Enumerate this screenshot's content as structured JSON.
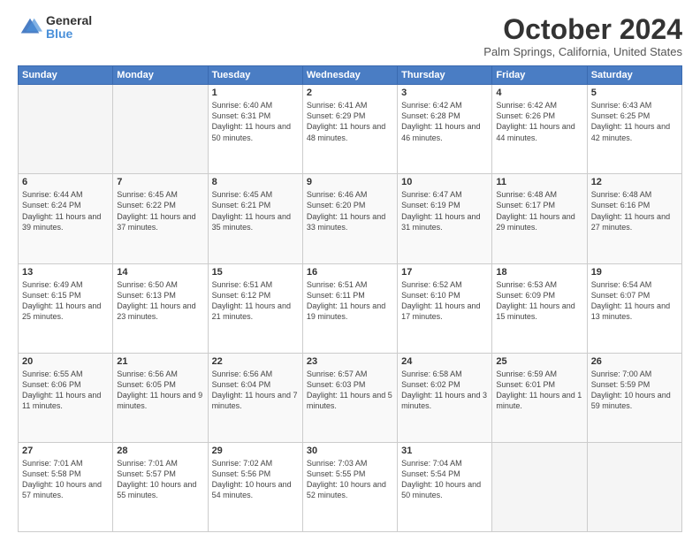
{
  "logo": {
    "general": "General",
    "blue": "Blue"
  },
  "header": {
    "month": "October 2024",
    "location": "Palm Springs, California, United States"
  },
  "weekdays": [
    "Sunday",
    "Monday",
    "Tuesday",
    "Wednesday",
    "Thursday",
    "Friday",
    "Saturday"
  ],
  "weeks": [
    [
      {
        "day": "",
        "info": ""
      },
      {
        "day": "",
        "info": ""
      },
      {
        "day": "1",
        "info": "Sunrise: 6:40 AM\nSunset: 6:31 PM\nDaylight: 11 hours and 50 minutes."
      },
      {
        "day": "2",
        "info": "Sunrise: 6:41 AM\nSunset: 6:29 PM\nDaylight: 11 hours and 48 minutes."
      },
      {
        "day": "3",
        "info": "Sunrise: 6:42 AM\nSunset: 6:28 PM\nDaylight: 11 hours and 46 minutes."
      },
      {
        "day": "4",
        "info": "Sunrise: 6:42 AM\nSunset: 6:26 PM\nDaylight: 11 hours and 44 minutes."
      },
      {
        "day": "5",
        "info": "Sunrise: 6:43 AM\nSunset: 6:25 PM\nDaylight: 11 hours and 42 minutes."
      }
    ],
    [
      {
        "day": "6",
        "info": "Sunrise: 6:44 AM\nSunset: 6:24 PM\nDaylight: 11 hours and 39 minutes."
      },
      {
        "day": "7",
        "info": "Sunrise: 6:45 AM\nSunset: 6:22 PM\nDaylight: 11 hours and 37 minutes."
      },
      {
        "day": "8",
        "info": "Sunrise: 6:45 AM\nSunset: 6:21 PM\nDaylight: 11 hours and 35 minutes."
      },
      {
        "day": "9",
        "info": "Sunrise: 6:46 AM\nSunset: 6:20 PM\nDaylight: 11 hours and 33 minutes."
      },
      {
        "day": "10",
        "info": "Sunrise: 6:47 AM\nSunset: 6:19 PM\nDaylight: 11 hours and 31 minutes."
      },
      {
        "day": "11",
        "info": "Sunrise: 6:48 AM\nSunset: 6:17 PM\nDaylight: 11 hours and 29 minutes."
      },
      {
        "day": "12",
        "info": "Sunrise: 6:48 AM\nSunset: 6:16 PM\nDaylight: 11 hours and 27 minutes."
      }
    ],
    [
      {
        "day": "13",
        "info": "Sunrise: 6:49 AM\nSunset: 6:15 PM\nDaylight: 11 hours and 25 minutes."
      },
      {
        "day": "14",
        "info": "Sunrise: 6:50 AM\nSunset: 6:13 PM\nDaylight: 11 hours and 23 minutes."
      },
      {
        "day": "15",
        "info": "Sunrise: 6:51 AM\nSunset: 6:12 PM\nDaylight: 11 hours and 21 minutes."
      },
      {
        "day": "16",
        "info": "Sunrise: 6:51 AM\nSunset: 6:11 PM\nDaylight: 11 hours and 19 minutes."
      },
      {
        "day": "17",
        "info": "Sunrise: 6:52 AM\nSunset: 6:10 PM\nDaylight: 11 hours and 17 minutes."
      },
      {
        "day": "18",
        "info": "Sunrise: 6:53 AM\nSunset: 6:09 PM\nDaylight: 11 hours and 15 minutes."
      },
      {
        "day": "19",
        "info": "Sunrise: 6:54 AM\nSunset: 6:07 PM\nDaylight: 11 hours and 13 minutes."
      }
    ],
    [
      {
        "day": "20",
        "info": "Sunrise: 6:55 AM\nSunset: 6:06 PM\nDaylight: 11 hours and 11 minutes."
      },
      {
        "day": "21",
        "info": "Sunrise: 6:56 AM\nSunset: 6:05 PM\nDaylight: 11 hours and 9 minutes."
      },
      {
        "day": "22",
        "info": "Sunrise: 6:56 AM\nSunset: 6:04 PM\nDaylight: 11 hours and 7 minutes."
      },
      {
        "day": "23",
        "info": "Sunrise: 6:57 AM\nSunset: 6:03 PM\nDaylight: 11 hours and 5 minutes."
      },
      {
        "day": "24",
        "info": "Sunrise: 6:58 AM\nSunset: 6:02 PM\nDaylight: 11 hours and 3 minutes."
      },
      {
        "day": "25",
        "info": "Sunrise: 6:59 AM\nSunset: 6:01 PM\nDaylight: 11 hours and 1 minute."
      },
      {
        "day": "26",
        "info": "Sunrise: 7:00 AM\nSunset: 5:59 PM\nDaylight: 10 hours and 59 minutes."
      }
    ],
    [
      {
        "day": "27",
        "info": "Sunrise: 7:01 AM\nSunset: 5:58 PM\nDaylight: 10 hours and 57 minutes."
      },
      {
        "day": "28",
        "info": "Sunrise: 7:01 AM\nSunset: 5:57 PM\nDaylight: 10 hours and 55 minutes."
      },
      {
        "day": "29",
        "info": "Sunrise: 7:02 AM\nSunset: 5:56 PM\nDaylight: 10 hours and 54 minutes."
      },
      {
        "day": "30",
        "info": "Sunrise: 7:03 AM\nSunset: 5:55 PM\nDaylight: 10 hours and 52 minutes."
      },
      {
        "day": "31",
        "info": "Sunrise: 7:04 AM\nSunset: 5:54 PM\nDaylight: 10 hours and 50 minutes."
      },
      {
        "day": "",
        "info": ""
      },
      {
        "day": "",
        "info": ""
      }
    ]
  ]
}
